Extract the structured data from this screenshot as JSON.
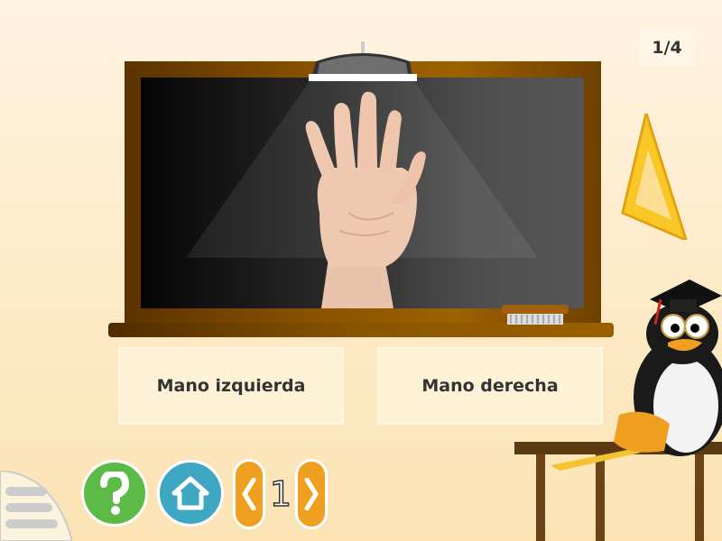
{
  "progress": {
    "counter": "1/4"
  },
  "answers": [
    {
      "label": "Mano izquierda"
    },
    {
      "label": "Mano derecha"
    }
  ],
  "controls": {
    "help_icon": "question-mark",
    "home_icon": "house",
    "page_number": "1"
  },
  "colors": {
    "help_button": "#5cba47",
    "home_button": "#3ea7c2",
    "nav_button": "#f0a020",
    "board_frame": "#8a5200"
  }
}
